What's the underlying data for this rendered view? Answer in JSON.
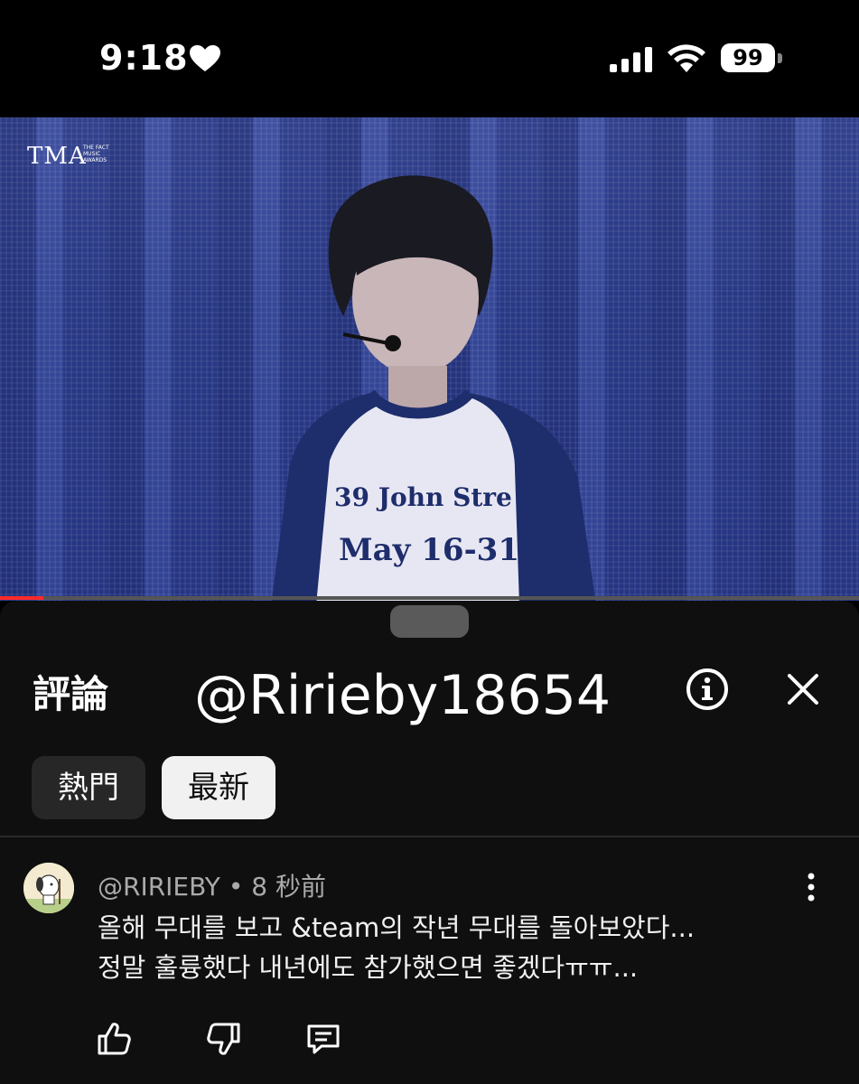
{
  "status_bar": {
    "time": "9:18",
    "battery": "99",
    "icons": [
      "heart-icon",
      "cellular-signal-icon",
      "wifi-icon",
      "battery-icon"
    ]
  },
  "video": {
    "logo_text": "TMA",
    "logo_subtitle_1": "THE FACT",
    "logo_subtitle_2": "MUSIC",
    "logo_subtitle_3": "AWARDS",
    "shirt_text_1": "39 John Stre",
    "shirt_text_2": "May 16-31",
    "progress": 0.05
  },
  "comments_panel": {
    "title": "評論",
    "overlay_handle": "@Ririeby18654",
    "filters": [
      {
        "label": "熱門",
        "selected": false
      },
      {
        "label": "最新",
        "selected": true
      }
    ]
  },
  "comment": {
    "author": "@RIRIEBY",
    "separator": "•",
    "time": "8 秒前",
    "line1": "올해 무대를 보고 &team의 작년 무대를 돌아보았다...",
    "line2": "정말 훌륭했다 내년에도 참가했으면 좋겠다ㅠㅠ..."
  },
  "colors": {
    "background": "#0f0f0f",
    "chip_selected": "#f1f1f1",
    "chip_unselected": "#272727",
    "secondary_text": "#aaaaaa",
    "progress": "#ff2a2a"
  }
}
